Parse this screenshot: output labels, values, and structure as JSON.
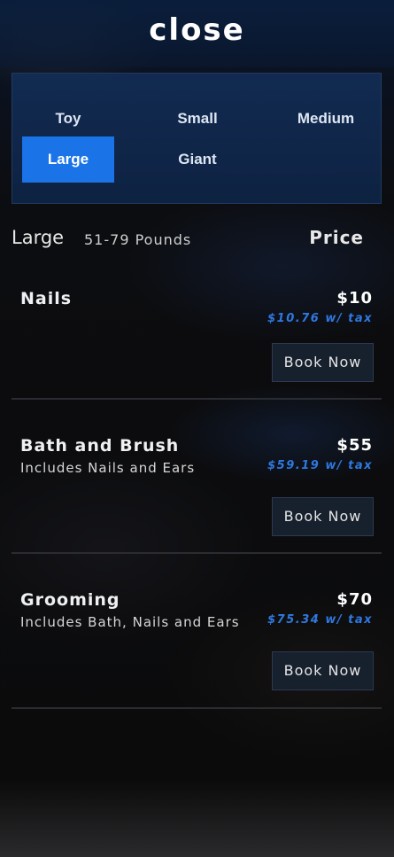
{
  "header": {
    "close_label": "close"
  },
  "sizes": {
    "options": [
      "Toy",
      "Small",
      "Medium",
      "Large",
      "Giant"
    ],
    "selected": "Large"
  },
  "category": {
    "name": "Large",
    "range": "51-79 Pounds",
    "price_heading": "Price"
  },
  "services": [
    {
      "name": "Nails",
      "description": "",
      "price": "$10",
      "price_with_tax": "$10.76 w/ tax",
      "book_label": "Book Now"
    },
    {
      "name": "Bath and Brush",
      "description": "Includes Nails and Ears",
      "price": "$55",
      "price_with_tax": "$59.19 w/ tax",
      "book_label": "Book Now"
    },
    {
      "name": "Grooming",
      "description": "Includes Bath, Nails and Ears",
      "price": "$70",
      "price_with_tax": "$75.34 w/ tax",
      "book_label": "Book Now"
    }
  ],
  "colors": {
    "accent": "#1a74e8",
    "tax_text": "#2f78e0",
    "panel_bg": "#122d55"
  }
}
